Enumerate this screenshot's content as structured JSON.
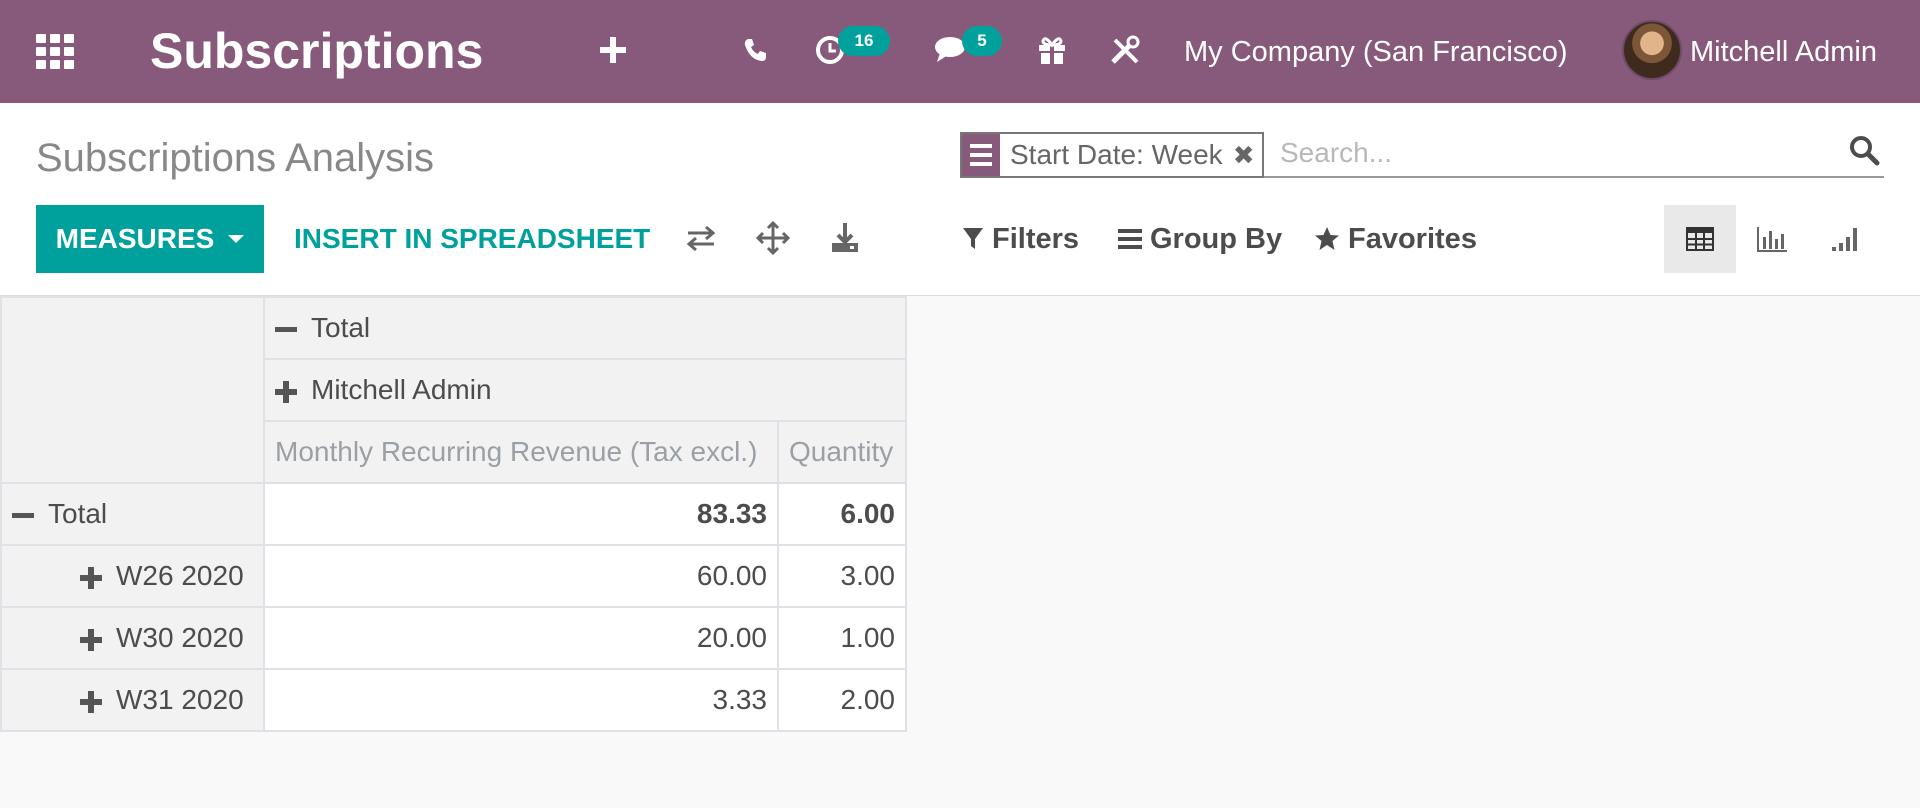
{
  "navbar": {
    "brand": "Subscriptions",
    "activity_count": "16",
    "messages_count": "5",
    "company": "My Company (San Francisco)",
    "user": "Mitchell Admin",
    "bg_color": "#875a7b",
    "badge_color": "#00a09d"
  },
  "control": {
    "title": "Subscriptions Analysis",
    "facet_value": "Start Date: Week",
    "search_placeholder": "Search...",
    "measures_label": "MEASURES",
    "insert_label": "INSERT IN SPREADSHEET",
    "filters_label": "Filters",
    "groupby_label": "Group By",
    "favorites_label": "Favorites",
    "accent_color": "#00a09d"
  },
  "pivot": {
    "col_total_label": "Total",
    "col_group_label": "Mitchell Admin",
    "measures": [
      "Monthly Recurring Revenue (Tax excl.)",
      "Quantity"
    ],
    "total_row": {
      "label": "Total",
      "mrr": "83.33",
      "qty": "6.00"
    },
    "rows": [
      {
        "label": "W26 2020",
        "mrr": "60.00",
        "qty": "3.00"
      },
      {
        "label": "W30 2020",
        "mrr": "20.00",
        "qty": "1.00"
      },
      {
        "label": "W31 2020",
        "mrr": "3.33",
        "qty": "2.00"
      }
    ]
  }
}
